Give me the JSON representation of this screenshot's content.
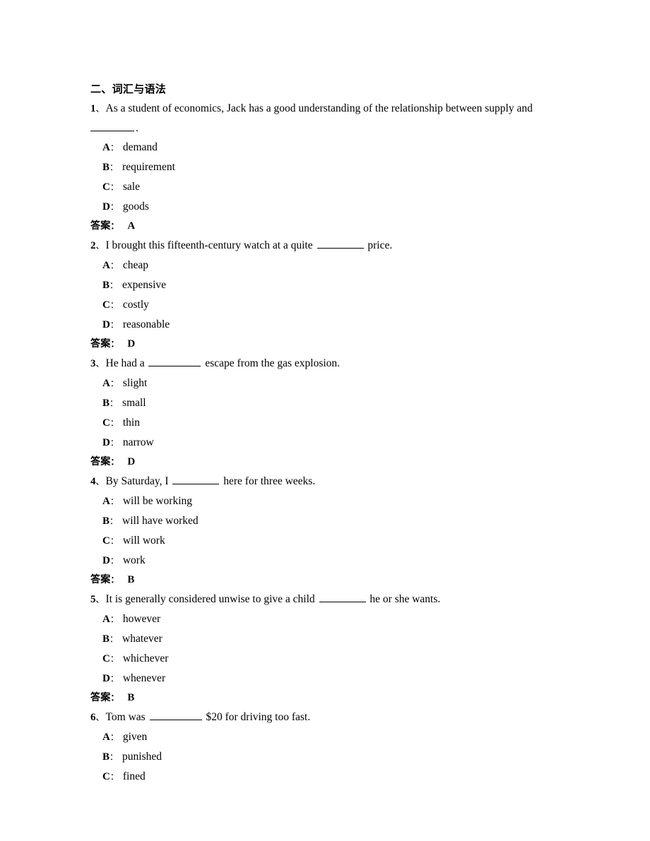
{
  "document": {
    "section_heading": "二、词汇与语法",
    "answer_label": "答案",
    "answer_colon": "：",
    "number_separator": "、",
    "option_colon": "："
  },
  "questions": [
    {
      "number": "1",
      "stem_before": "As a student of economics, Jack has a good understanding of the relationship between supply and",
      "stem_after": "",
      "continuation_before": "",
      "continuation_after": ".",
      "blank_in_continuation": true,
      "blank_size": "blank-lead",
      "options": [
        {
          "letter": "A",
          "text": "demand"
        },
        {
          "letter": "B",
          "text": "requirement"
        },
        {
          "letter": "C",
          "text": "sale"
        },
        {
          "letter": "D",
          "text": "goods"
        }
      ],
      "answer": "A"
    },
    {
      "number": "2",
      "stem_before": "I brought this fifteenth-century watch at a quite",
      "stem_after": "price.",
      "continuation_before": "",
      "continuation_after": "",
      "blank_in_continuation": false,
      "blank_size": "blank-m",
      "options": [
        {
          "letter": "A",
          "text": "cheap"
        },
        {
          "letter": "B",
          "text": "expensive"
        },
        {
          "letter": "C",
          "text": "costly"
        },
        {
          "letter": "D",
          "text": "reasonable"
        }
      ],
      "answer": "D"
    },
    {
      "number": "3",
      "stem_before": "He had a",
      "stem_after": "escape from the gas explosion.",
      "continuation_before": "",
      "continuation_after": "",
      "blank_in_continuation": false,
      "blank_size": "blank-l",
      "options": [
        {
          "letter": "A",
          "text": "slight"
        },
        {
          "letter": "B",
          "text": "small"
        },
        {
          "letter": "C",
          "text": "thin"
        },
        {
          "letter": "D",
          "text": "narrow"
        }
      ],
      "answer": "D"
    },
    {
      "number": "4",
      "stem_before": "By Saturday, I",
      "stem_after": "here for three weeks.",
      "continuation_before": "",
      "continuation_after": "",
      "blank_in_continuation": false,
      "blank_size": "blank-m",
      "options": [
        {
          "letter": "A",
          "text": "will be working"
        },
        {
          "letter": "B",
          "text": "will have worked"
        },
        {
          "letter": "C",
          "text": "will work"
        },
        {
          "letter": "D",
          "text": "work"
        }
      ],
      "answer": "B"
    },
    {
      "number": "5",
      "stem_before": "It is generally considered unwise to give a child",
      "stem_after": "he or she wants.",
      "continuation_before": "",
      "continuation_after": "",
      "blank_in_continuation": false,
      "blank_size": "blank-m",
      "options": [
        {
          "letter": "A",
          "text": "however"
        },
        {
          "letter": "B",
          "text": "whatever"
        },
        {
          "letter": "C",
          "text": "whichever"
        },
        {
          "letter": "D",
          "text": "whenever"
        }
      ],
      "answer": "B"
    },
    {
      "number": "6",
      "stem_before": "Tom was",
      "stem_after": "$20 for driving too fast.",
      "continuation_before": "",
      "continuation_after": "",
      "blank_in_continuation": false,
      "blank_size": "blank-l",
      "options": [
        {
          "letter": "A",
          "text": "given"
        },
        {
          "letter": "B",
          "text": "punished"
        },
        {
          "letter": "C",
          "text": "fined"
        }
      ],
      "answer": ""
    }
  ]
}
